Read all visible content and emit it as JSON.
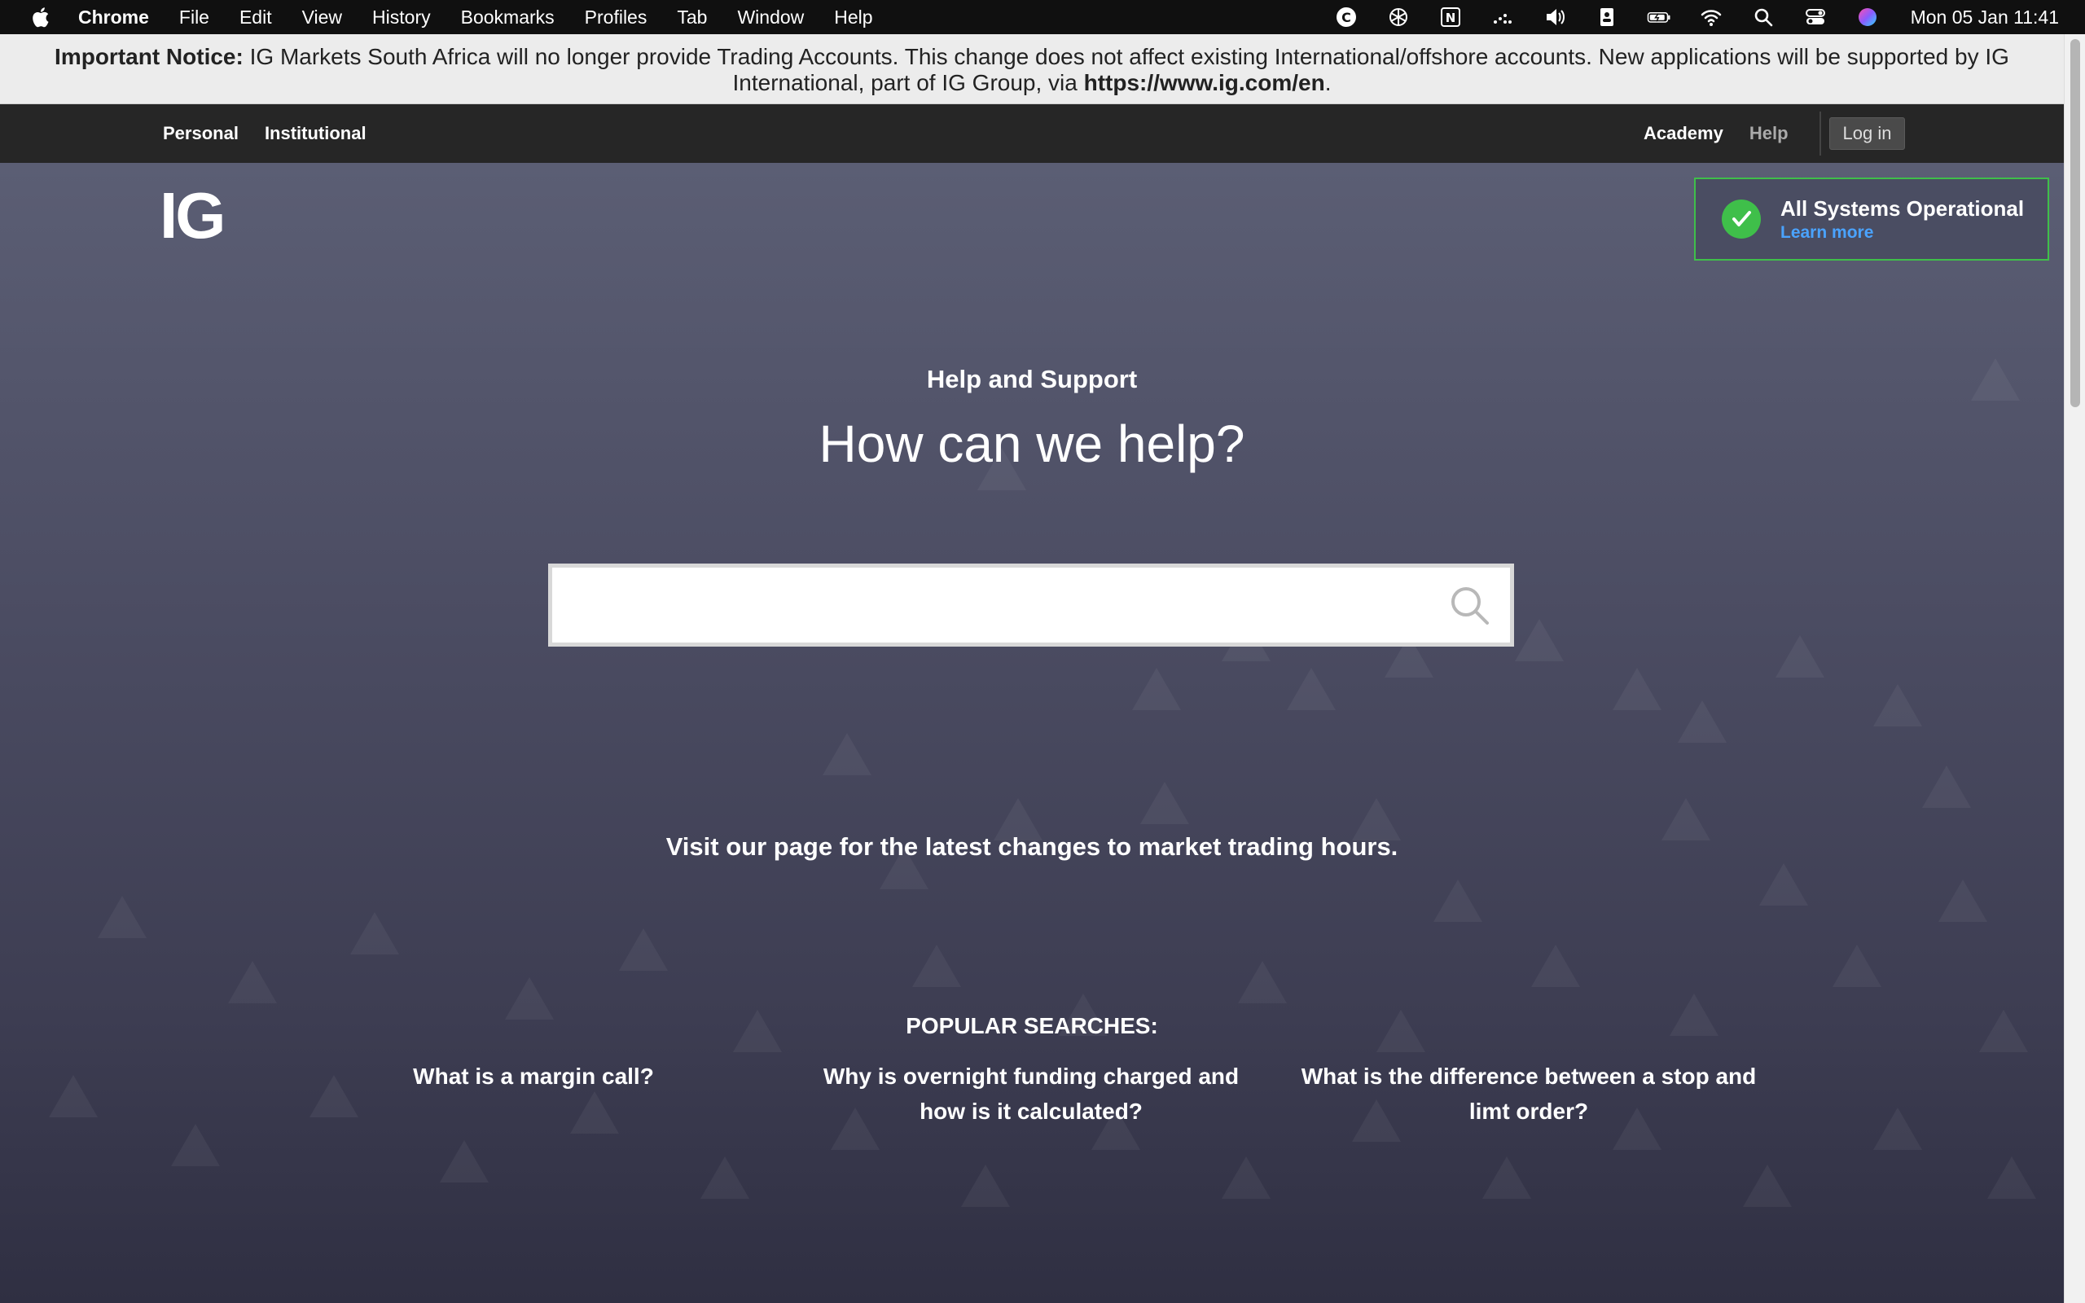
{
  "menubar": {
    "app_name": "Chrome",
    "items": [
      "File",
      "Edit",
      "View",
      "History",
      "Bookmarks",
      "Profiles",
      "Tab",
      "Window",
      "Help"
    ],
    "clock": "Mon 05 Jan  11:41"
  },
  "notice": {
    "label": "Important Notice:",
    "text": "IG Markets South Africa will no longer provide Trading Accounts. This change does not affect existing International/offshore accounts. New applications will be supported by IG International, part of IG Group, via",
    "link": "https://www.ig.com/en",
    "end": "."
  },
  "topnav": {
    "personal": "Personal",
    "institutional": "Institutional",
    "academy": "Academy",
    "help": "Help",
    "login": "Log in"
  },
  "logo": "IG",
  "status": {
    "title": "All Systems Operational",
    "learn_more": "Learn more",
    "color": "#3fbf4a"
  },
  "hero": {
    "kicker": "Help and Support",
    "heading": "How can we help?",
    "search_value": "",
    "visit_text": "Visit our page for the latest changes to market trading hours."
  },
  "popular": {
    "title": "POPULAR SEARCHES:",
    "items": [
      "What is a margin call?",
      "Why is overnight funding charged and how is it calculated?",
      "What is the difference between a stop and limt order?"
    ]
  },
  "colors": {
    "accent_link": "#4aa3ff",
    "hero_bg": "#4b4c62"
  }
}
